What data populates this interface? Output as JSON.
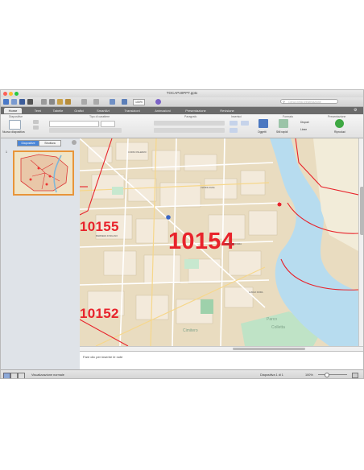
{
  "window": {
    "title": "TOCAP40PPT.pptx"
  },
  "toolbar": {
    "zoom": "100%",
    "search_placeholder": "Cerca nella presentazione",
    "icons": [
      "new-doc-icon",
      "templates-icon",
      "save-icon",
      "print-icon",
      "cut-icon",
      "copy-icon",
      "paste-icon",
      "format-icon",
      "undo-icon",
      "redo-icon",
      "media-icon",
      "table-icon",
      "help-icon",
      "search-icon",
      "settings-icon"
    ]
  },
  "ribbon": {
    "tabs": [
      "Home",
      "Temi",
      "Tabelle",
      "Grafici",
      "SmartArt",
      "Transizioni",
      "Animazioni",
      "Presentazione",
      "Revisione"
    ],
    "active_tab": "Home",
    "groups": {
      "slides": "Diapositive",
      "font": "Tipo di carattere",
      "paragraph": "Paragrafo",
      "insert": "Inserisci",
      "format": "Formato",
      "slideshow": "Presentazione"
    },
    "new_slide_label": "Nuova diapositiva",
    "objects_label": "Oggetti",
    "quick_styles_label": "Stili rapidi",
    "arrange_label": "Disponi",
    "shapes_label": "Linee",
    "play_label": "Riproduci"
  },
  "left_pane": {
    "tab_slides": "Diapositive",
    "tab_outline": "Struttura",
    "slide_number": "1"
  },
  "map": {
    "zip_labels": [
      "10154",
      "10155",
      "10152"
    ],
    "street_labels": [
      "CORSO PALERMO",
      "VIA BOLOGNA",
      "Cimitero",
      "Parco",
      "Colletta",
      "CORSO NOVARA",
      "LUNGO DORA",
      "BARRIERA DI MILANO"
    ]
  },
  "notes": {
    "placeholder": "Fare clic per inserire le note"
  },
  "status": {
    "view_label": "Visualizzazione normale",
    "slide_counter": "Diapositiva 1 di 1",
    "zoom": "100%"
  },
  "colors": {
    "accent": "#e8232b",
    "tab_bar": "#6b6b6b",
    "thumb_border": "#e8953a"
  }
}
